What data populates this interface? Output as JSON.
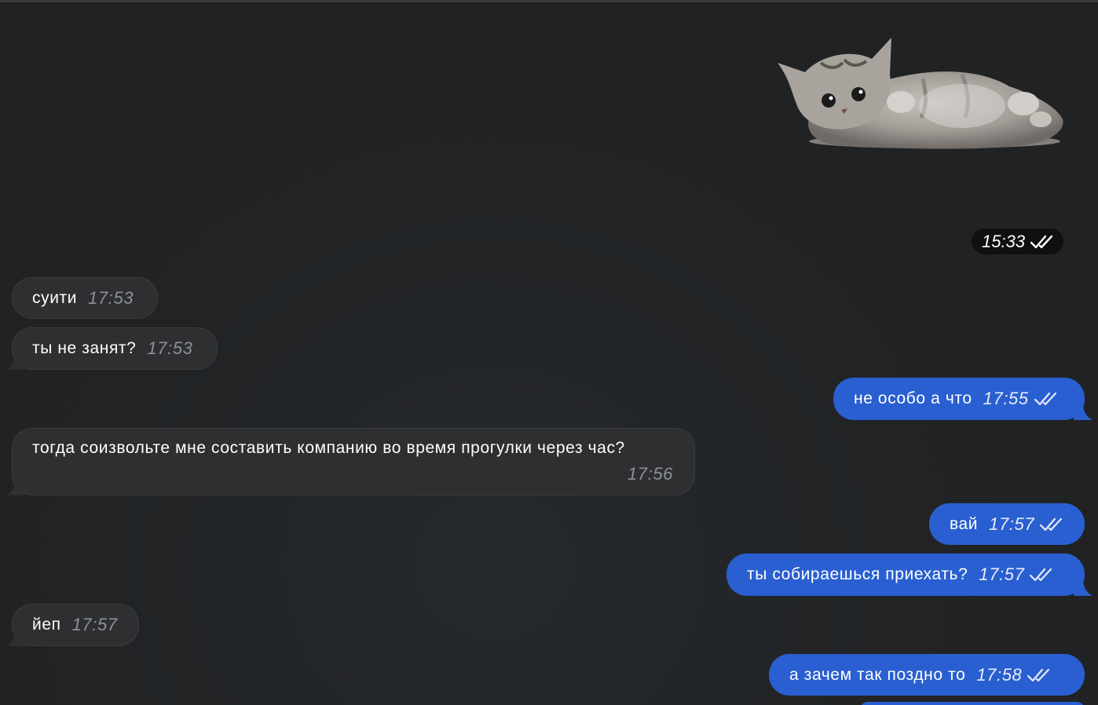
{
  "sticker": {
    "icon": "kitten-sticker",
    "time": "15:33",
    "status": "read"
  },
  "messages": [
    {
      "direction": "in",
      "text": "суити",
      "time": "17:53"
    },
    {
      "direction": "in",
      "text": "ты не занят?",
      "time": "17:53"
    },
    {
      "direction": "out",
      "text": "не особо а что",
      "time": "17:55",
      "status": "read"
    },
    {
      "direction": "in",
      "text": "тогда соизвольте мне составить компанию во время прогулки через час?",
      "time": "17:56"
    },
    {
      "direction": "out",
      "text": "вай",
      "time": "17:57",
      "status": "read"
    },
    {
      "direction": "out",
      "text": "ты собираешься приехать?",
      "time": "17:57",
      "status": "read"
    },
    {
      "direction": "in",
      "text": "йеп",
      "time": "17:57"
    },
    {
      "direction": "out",
      "text": "а зачем так поздно то",
      "time": "17:58",
      "status": "read"
    }
  ],
  "colors": {
    "background": "#212325",
    "incoming_bubble": "#2e2f31",
    "outgoing_bubble": "#2a5fd1",
    "time_pill": "#0f1011"
  }
}
